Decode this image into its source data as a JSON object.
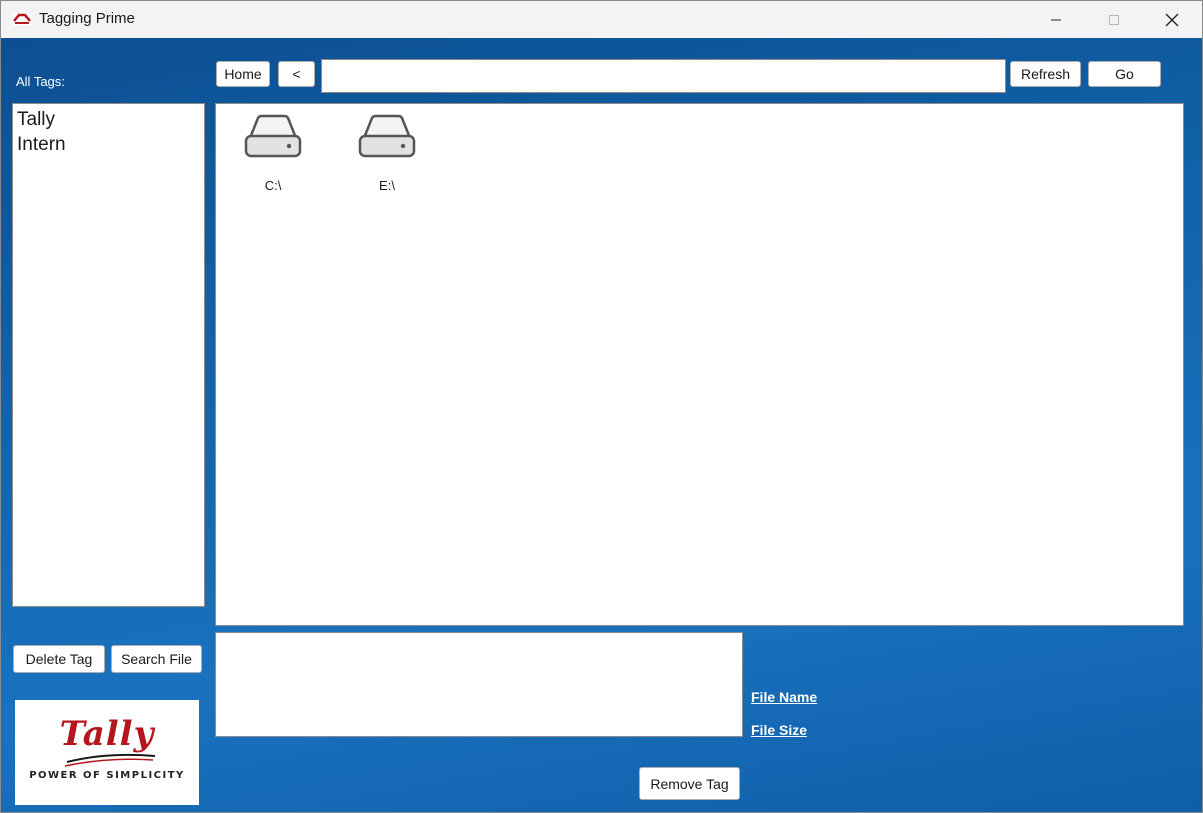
{
  "window": {
    "title": "Tagging Prime"
  },
  "sidebar": {
    "all_tags_label": "All Tags:",
    "tags": [
      "Tally",
      "Intern"
    ],
    "delete_tag_label": "Delete Tag",
    "search_file_label": "Search File"
  },
  "toolbar": {
    "home_label": "Home",
    "back_label": "<",
    "path_value": "",
    "refresh_label": "Refresh",
    "go_label": "Go"
  },
  "browser": {
    "drives": [
      {
        "label": "C:\\",
        "icon": "hard-drive-icon"
      },
      {
        "label": "E:\\",
        "icon": "hard-drive-icon"
      }
    ]
  },
  "details": {
    "tag_input_value": "",
    "file_name_label": "File Name",
    "file_size_label": "File Size",
    "remove_tag_label": "Remove Tag"
  },
  "logo": {
    "word": "Tally",
    "tagline": "POWER OF SIMPLICITY"
  },
  "colors": {
    "background_top": "#0d4f92",
    "background_bottom": "#1a72bf",
    "logo_red": "#b3161c"
  }
}
